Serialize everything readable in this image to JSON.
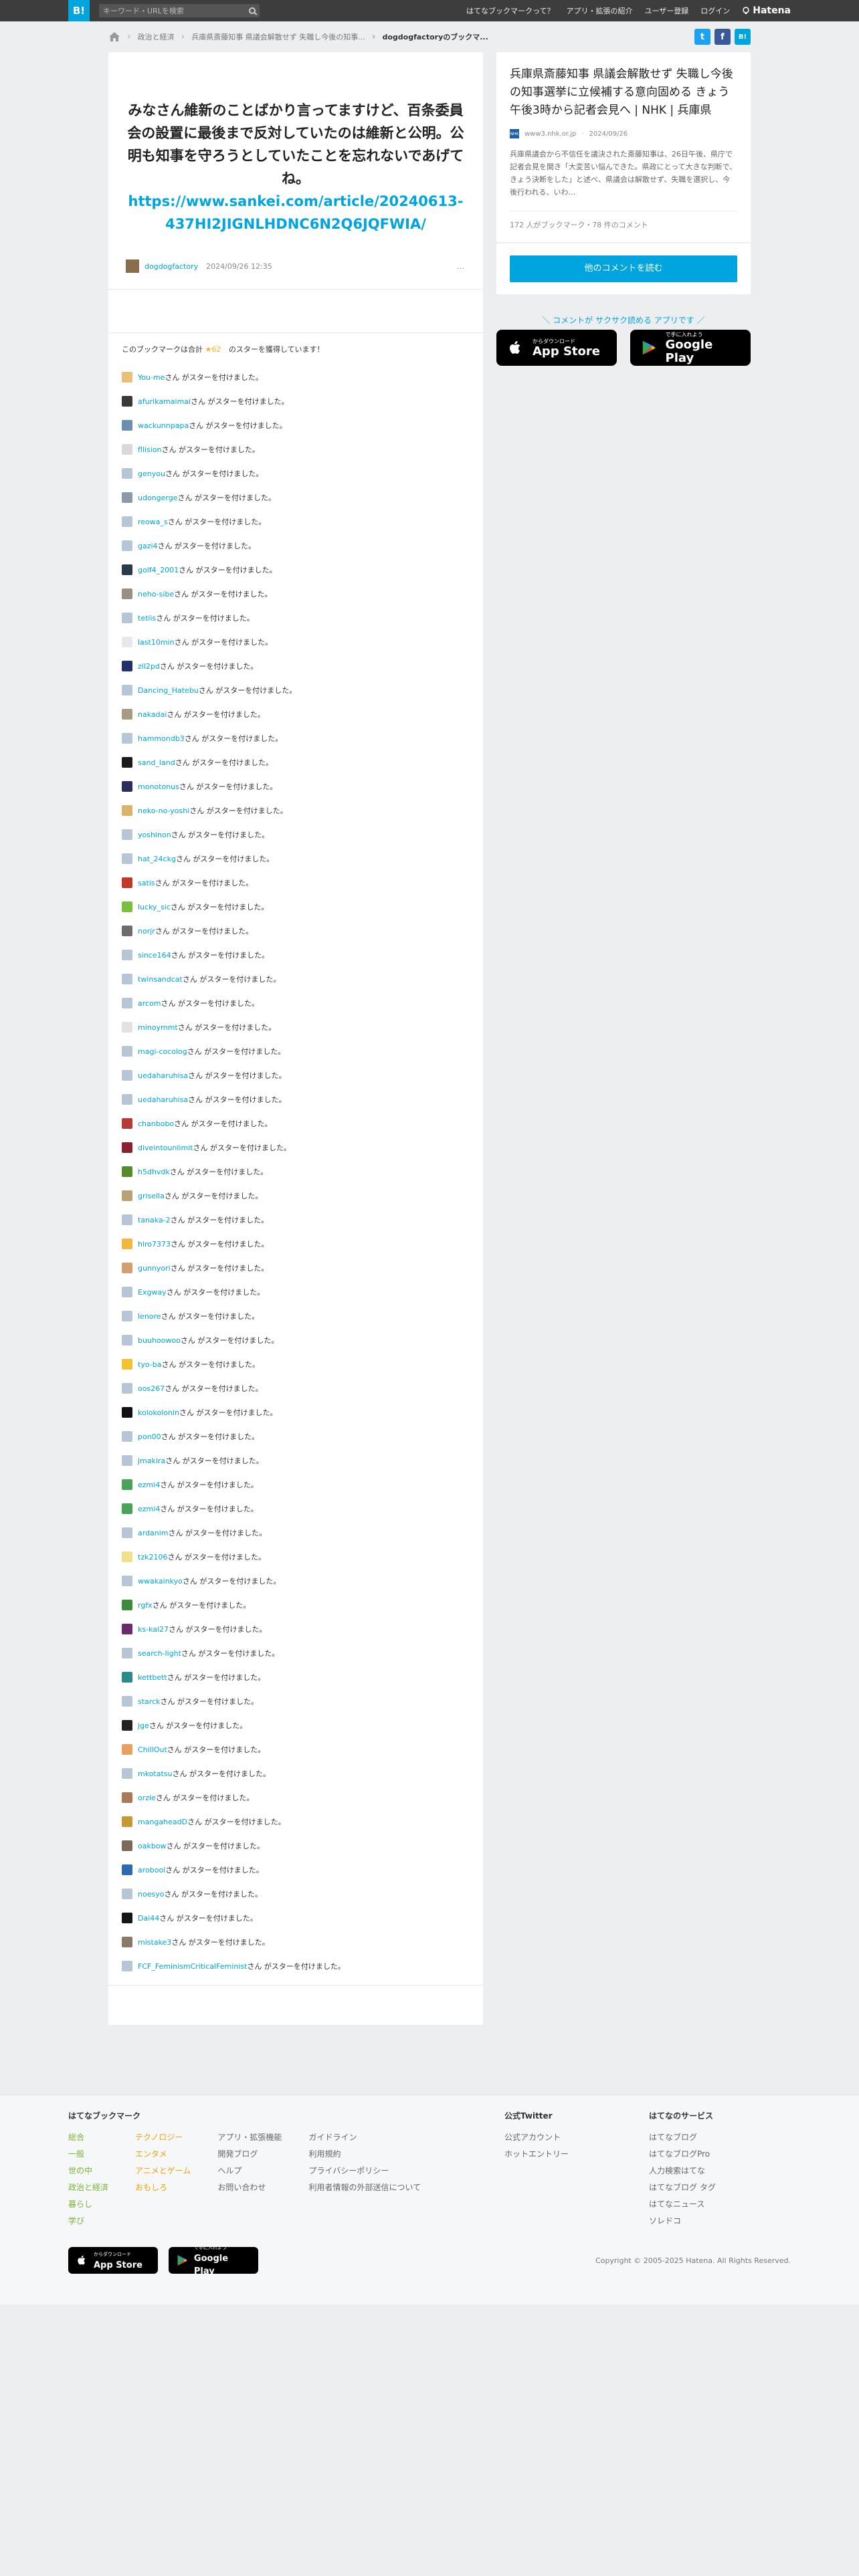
{
  "header": {
    "logo": "B!",
    "search_placeholder": "キーワード・URLを検索",
    "links": [
      "はてなブックマークって？",
      "アプリ・拡張の紹介",
      "ユーザー登録",
      "ログイン"
    ],
    "hatena": "Hatena"
  },
  "breadcrumb": {
    "items": [
      "政治と経済",
      "兵庫県斎藤知事 県議会解散せず 失職し今後の知事..."
    ],
    "current": "dogdogfactoryのブックマ..."
  },
  "share": {
    "twitter": "t",
    "facebook": "f",
    "hatebu": "B!"
  },
  "comment": {
    "text": "みなさん維新のことばかり言ってますけど、百条委員会の設置に最後まで反対していたのは維新と公明。公明も知事を守ろうとしていたことを忘れないであげてね。",
    "url": "https://www.sankei.com/article/20240613-437HI2JIGNLHDNC6N2Q6JQFWIA/",
    "user": "dogdogfactory",
    "date": "2024/09/26 12:35",
    "more": "…"
  },
  "stars": {
    "summary_pre": "このブックマークは合計",
    "star_icon": "★",
    "count": "62",
    "summary_post": "のスターを獲得しています！",
    "suffix": "さん がスターを付けました。",
    "users": [
      {
        "name": "You-me",
        "color": "#e7c17a"
      },
      {
        "name": "afurikamaimai",
        "color": "#3a3a3a"
      },
      {
        "name": "wackunnpapa",
        "color": "#6a8fb0"
      },
      {
        "name": "fllision",
        "color": "#d9d9d9"
      },
      {
        "name": "genyou",
        "color": "#b7c6d6"
      },
      {
        "name": "udongerge",
        "color": "#8c9aa8"
      },
      {
        "name": "reowa_s",
        "color": "#b7c6d6"
      },
      {
        "name": "gazi4",
        "color": "#b7c6d6"
      },
      {
        "name": "golf4_2001",
        "color": "#2b3a4a"
      },
      {
        "name": "neho-sibe",
        "color": "#9a9080"
      },
      {
        "name": "tetlis",
        "color": "#b7c6d6"
      },
      {
        "name": "last10min",
        "color": "#e8e8e8"
      },
      {
        "name": "zll2pd",
        "color": "#23306e"
      },
      {
        "name": "Dancing_Hatebu",
        "color": "#b7c6d6"
      },
      {
        "name": "nakadai",
        "color": "#a79b83"
      },
      {
        "name": "hammondb3",
        "color": "#b7c6d6"
      },
      {
        "name": "sand_land",
        "color": "#1b1b1b"
      },
      {
        "name": "monotonus",
        "color": "#2d2d5c"
      },
      {
        "name": "neko-no-yoshi",
        "color": "#d9b46a"
      },
      {
        "name": "yoshinon",
        "color": "#b7c6d6"
      },
      {
        "name": "hat_24ckg",
        "color": "#b7c6d6"
      },
      {
        "name": "satis",
        "color": "#c0392b"
      },
      {
        "name": "lucky_sic",
        "color": "#7cbf3f"
      },
      {
        "name": "norjr",
        "color": "#6d6d6d"
      },
      {
        "name": "since164",
        "color": "#b7c6d6"
      },
      {
        "name": "twinsandcat",
        "color": "#b7c6d6"
      },
      {
        "name": "arcom",
        "color": "#b7c6d6"
      },
      {
        "name": "minoymmt",
        "color": "#e2e2e2"
      },
      {
        "name": "magi-cocolog",
        "color": "#b7c6d6"
      },
      {
        "name": "uedaharuhisa",
        "color": "#b7c6d6"
      },
      {
        "name": "uedaharuhisa",
        "color": "#b7c6d6"
      },
      {
        "name": "chanbobo",
        "color": "#b63a3a"
      },
      {
        "name": "diveintounlimit",
        "color": "#8b2030"
      },
      {
        "name": "h5dhvdk",
        "color": "#5a8a2b"
      },
      {
        "name": "grisella",
        "color": "#b9a27a"
      },
      {
        "name": "tanaka-2",
        "color": "#b7c6d6"
      },
      {
        "name": "hiro7373",
        "color": "#f0b840"
      },
      {
        "name": "gunnyori",
        "color": "#d1a070"
      },
      {
        "name": "Exgway",
        "color": "#b7c6d6"
      },
      {
        "name": "lenore",
        "color": "#b7c6d6"
      },
      {
        "name": "buuhoowoo",
        "color": "#b7c6d6"
      },
      {
        "name": "tyo-ba",
        "color": "#f1c232"
      },
      {
        "name": "oos267",
        "color": "#b7c6d6"
      },
      {
        "name": "kolokolonin",
        "color": "#111111"
      },
      {
        "name": "pon00",
        "color": "#b7c6d6"
      },
      {
        "name": "jmakira",
        "color": "#b7c6d6"
      },
      {
        "name": "ezmi4",
        "color": "#4aa35a"
      },
      {
        "name": "ezmi4",
        "color": "#4aa35a"
      },
      {
        "name": "ardanim",
        "color": "#b7c6d6"
      },
      {
        "name": "tzk2106",
        "color": "#f1e08a"
      },
      {
        "name": "wwakainkyo",
        "color": "#b7c6d6"
      },
      {
        "name": "rgfx",
        "color": "#3f8a3c"
      },
      {
        "name": "ks-kai27",
        "color": "#6a2c6a"
      },
      {
        "name": "search-light",
        "color": "#b7c6d6"
      },
      {
        "name": "kettbett",
        "color": "#2d8a8a"
      },
      {
        "name": "starck",
        "color": "#b7c6d6"
      },
      {
        "name": "jge",
        "color": "#222222"
      },
      {
        "name": "ChillOut",
        "color": "#e8a060"
      },
      {
        "name": "mkotatsu",
        "color": "#b7c6d6"
      },
      {
        "name": "orzie",
        "color": "#a87a5a"
      },
      {
        "name": "mangaheadD",
        "color": "#c59a35"
      },
      {
        "name": "oakbow",
        "color": "#7a6a5a"
      },
      {
        "name": "arobool",
        "color": "#2d6ab0"
      },
      {
        "name": "noesyo",
        "color": "#b7c6d6"
      },
      {
        "name": "Dai44",
        "color": "#151515"
      },
      {
        "name": "mistake3",
        "color": "#8a7a6a"
      },
      {
        "name": "FCF_FeminismCriticalFeminist",
        "color": "#b7c6d6"
      }
    ]
  },
  "entry": {
    "title": "兵庫県斎藤知事 県議会解散せず 失職し今後の知事選挙に立候補する意向固める きょう午後3時から記者会見へ | NHK | 兵庫県",
    "favicon": "NHK",
    "domain": "www3.nhk.or.jp",
    "date": "2024/09/26",
    "description": "兵庫県議会から不信任を議決された斎藤知事は、26日午後、県庁で記者会見を開き「大変苦い悩んできた。県政にとって大きな判断で、きょう決断をした」と述べ、県議会は解散せず、失職を選択し、今後行われる、いわ...",
    "stats": "172 人がブックマーク・78 件のコメント",
    "other_button": "他のコメントを読む"
  },
  "app_promo": {
    "lead": "＼ コメントが サクサク読める アプリです ／",
    "appstore_big": "App Store",
    "appstore_small": "からダウンロード",
    "googleplay_big": "Google Play",
    "googleplay_small": "で手に入れよう"
  },
  "footer": {
    "col1_title": "はてなブックマーク",
    "col1_green": [
      "総合",
      "一般",
      "世の中",
      "政治と経済",
      "暮らし",
      "学び"
    ],
    "col1_orange": [
      "テクノロジー",
      "エンタメ",
      "アニメとゲーム",
      "おもしろ"
    ],
    "col1_gray1": [
      "アプリ・拡張機能",
      "開発ブログ",
      "ヘルプ",
      "お問い合わせ"
    ],
    "col1_gray2": [
      "ガイドライン",
      "利用規約",
      "プライバシーポリシー",
      "利用者情報の外部送信について"
    ],
    "col2_title": "公式Twitter",
    "col2_links": [
      "公式アカウント",
      "ホットエントリー"
    ],
    "col3_title": "はてなのサービス",
    "col3_links": [
      "はてなブログ",
      "はてなブログPro",
      "人力検索はてな",
      "はてなブログ タグ",
      "はてなニュース",
      "ソレドコ"
    ],
    "appstore_big": "App Store",
    "appstore_small": "からダウンロード",
    "googleplay_big": "Google Play",
    "googleplay_small": "で手に入れよう",
    "copyright": "Copyright © 2005-2025 Hatena. All Rights Reserved."
  }
}
